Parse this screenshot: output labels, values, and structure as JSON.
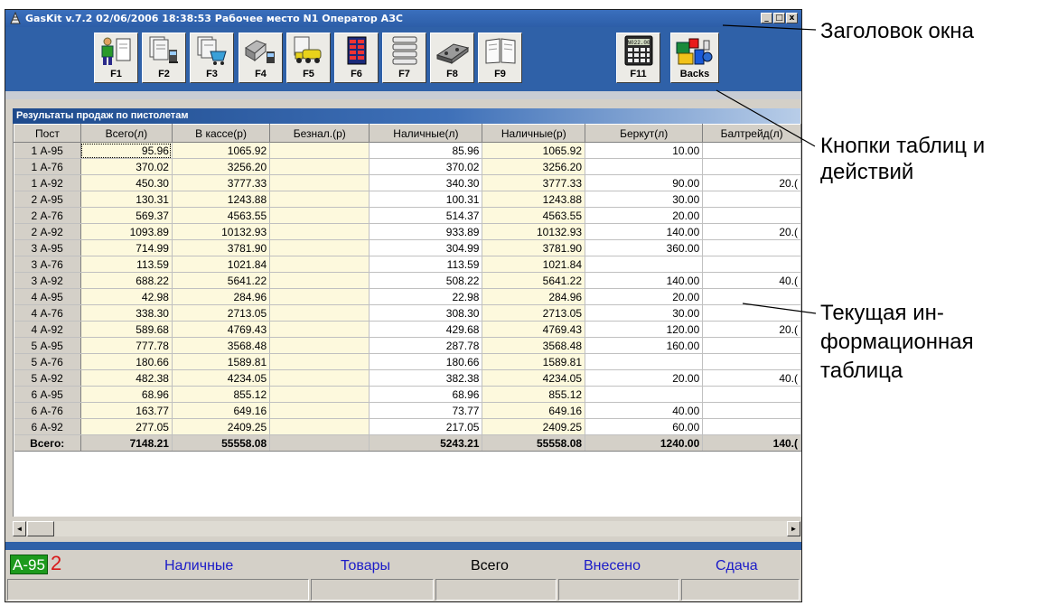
{
  "window": {
    "title": "GasKit v.7.2  02/06/2006 18:38:53  Рабочее место N1  Оператор АЗС",
    "controls": [
      "_",
      "□",
      "x"
    ]
  },
  "toolbar": {
    "buttons": [
      {
        "key": "F1",
        "icon": "cashier-document-icon"
      },
      {
        "key": "F2",
        "icon": "documents-pump-icon"
      },
      {
        "key": "F3",
        "icon": "documents-cart-icon"
      },
      {
        "key": "F4",
        "icon": "tanks-pump-icon"
      },
      {
        "key": "F5",
        "icon": "fuel-truck-icon"
      },
      {
        "key": "F6",
        "icon": "price-board-icon"
      },
      {
        "key": "F7",
        "icon": "stacked-list-icon"
      },
      {
        "key": "F8",
        "icon": "tanks-icon"
      },
      {
        "key": "F9",
        "icon": "book-icon"
      },
      {
        "key": "F11",
        "icon": "calculator-icon"
      },
      {
        "key": "Backs",
        "icon": "goods-icon"
      }
    ],
    "calculator_display": "N022.00"
  },
  "panel": {
    "title": "Результаты продаж по пистолетам"
  },
  "table": {
    "columns": [
      "Пост",
      "Всего(л)",
      "В кассе(р)",
      "Безнал.(р)",
      "Наличные(л)",
      "Наличные(р)",
      "Беркут(л)",
      "Балтрейд(л)"
    ],
    "rows": [
      [
        "1 А-95",
        "95.96",
        "1065.92",
        "",
        "85.96",
        "1065.92",
        "10.00",
        ""
      ],
      [
        "1 А-76",
        "370.02",
        "3256.20",
        "",
        "370.02",
        "3256.20",
        "",
        ""
      ],
      [
        "1 А-92",
        "450.30",
        "3777.33",
        "",
        "340.30",
        "3777.33",
        "90.00",
        "20.("
      ],
      [
        "2 А-95",
        "130.31",
        "1243.88",
        "",
        "100.31",
        "1243.88",
        "30.00",
        ""
      ],
      [
        "2 А-76",
        "569.37",
        "4563.55",
        "",
        "514.37",
        "4563.55",
        "20.00",
        ""
      ],
      [
        "2 А-92",
        "1093.89",
        "10132.93",
        "",
        "933.89",
        "10132.93",
        "140.00",
        "20.("
      ],
      [
        "3 А-95",
        "714.99",
        "3781.90",
        "",
        "304.99",
        "3781.90",
        "360.00",
        ""
      ],
      [
        "3 А-76",
        "113.59",
        "1021.84",
        "",
        "113.59",
        "1021.84",
        "",
        ""
      ],
      [
        "3 А-92",
        "688.22",
        "5641.22",
        "",
        "508.22",
        "5641.22",
        "140.00",
        "40.("
      ],
      [
        "4 А-95",
        "42.98",
        "284.96",
        "",
        "22.98",
        "284.96",
        "20.00",
        ""
      ],
      [
        "4 А-76",
        "338.30",
        "2713.05",
        "",
        "308.30",
        "2713.05",
        "30.00",
        ""
      ],
      [
        "4 А-92",
        "589.68",
        "4769.43",
        "",
        "429.68",
        "4769.43",
        "120.00",
        "20.("
      ],
      [
        "5 А-95",
        "777.78",
        "3568.48",
        "",
        "287.78",
        "3568.48",
        "160.00",
        ""
      ],
      [
        "5 А-76",
        "180.66",
        "1589.81",
        "",
        "180.66",
        "1589.81",
        "",
        ""
      ],
      [
        "5 А-92",
        "482.38",
        "4234.05",
        "",
        "382.38",
        "4234.05",
        "20.00",
        "40.("
      ],
      [
        "6 А-95",
        "68.96",
        "855.12",
        "",
        "68.96",
        "855.12",
        "",
        ""
      ],
      [
        "6 А-76",
        "163.77",
        "649.16",
        "",
        "73.77",
        "649.16",
        "40.00",
        ""
      ],
      [
        "6 А-92",
        "277.05",
        "2409.25",
        "",
        "217.05",
        "2409.25",
        "60.00",
        ""
      ]
    ],
    "total": [
      "Всего:",
      "7148.21",
      "55558.08",
      "",
      "5243.21",
      "55558.08",
      "1240.00",
      "140.("
    ]
  },
  "scrollbar": {
    "left": "◄",
    "right": "►"
  },
  "status": {
    "fuel": "А-95",
    "nozzle": "2",
    "labels": [
      "Наличные",
      "Товары",
      "Всего",
      "Внесено",
      "Сдача"
    ],
    "colors": {
      "fuel_bg": "#1d9a1d",
      "nozzle": "#d81818",
      "label_blue": "#1b1bc8",
      "label_black": "#000000"
    }
  },
  "annotations": {
    "title": "Заголовок окна",
    "buttons": [
      "Кнопки таблиц и",
      "действий"
    ],
    "table": [
      "Текущая ин-",
      "формационная",
      "таблица"
    ]
  }
}
